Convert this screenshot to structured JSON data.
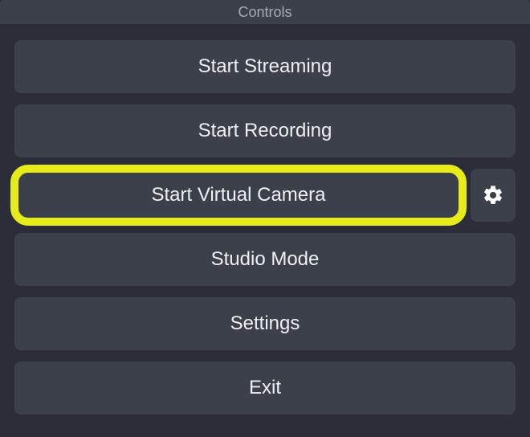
{
  "panel": {
    "title": "Controls"
  },
  "buttons": {
    "start_streaming": "Start Streaming",
    "start_recording": "Start Recording",
    "start_virtual_camera": "Start Virtual Camera",
    "studio_mode": "Studio Mode",
    "settings": "Settings",
    "exit": "Exit"
  },
  "highlight": {
    "target": "start_virtual_camera",
    "color": "#e7eb17"
  },
  "icons": {
    "virtual_camera_settings": "gear-icon"
  }
}
